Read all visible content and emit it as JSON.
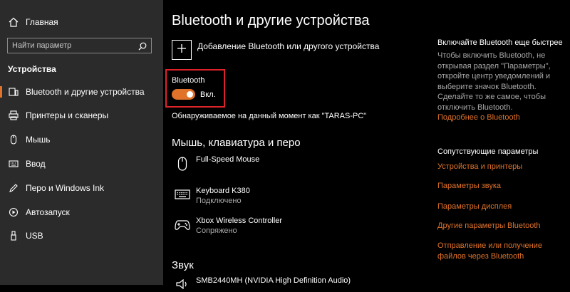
{
  "sidebar": {
    "home_label": "Главная",
    "search_placeholder": "Найти параметр",
    "section_label": "Устройства",
    "items": [
      {
        "label": "Bluetooth и другие устройства",
        "icon": "bluetooth-devices-icon"
      },
      {
        "label": "Принтеры и сканеры",
        "icon": "printer-icon"
      },
      {
        "label": "Мышь",
        "icon": "mouse-icon"
      },
      {
        "label": "Ввод",
        "icon": "keyboard-icon"
      },
      {
        "label": "Перо и Windows Ink",
        "icon": "pen-icon"
      },
      {
        "label": "Автозапуск",
        "icon": "autoplay-icon"
      },
      {
        "label": "USB",
        "icon": "usb-icon"
      }
    ]
  },
  "main": {
    "title": "Bluetooth и другие устройства",
    "add_label": "Добавление Bluetooth или другого устройства",
    "bluetooth_label": "Bluetooth",
    "toggle_state": "Вкл.",
    "toggle_on": true,
    "discoverable_text": "Обнаруживаемое на данный момент как \"TARAS-PC\"",
    "section_mouse": "Мышь, клавиатура и перо",
    "devices": [
      {
        "name": "Full-Speed Mouse",
        "status": "",
        "icon": "mouse-icon"
      },
      {
        "name": "Keyboard K380",
        "status": "Подключено",
        "icon": "keyboard-icon"
      },
      {
        "name": "Xbox Wireless Controller",
        "status": "Сопряжено",
        "icon": "gamepad-icon"
      }
    ],
    "section_sound": "Звук",
    "sound_devices": [
      {
        "name": "SMB2440MH (NVIDIA High Definition Audio)",
        "icon": "speaker-icon"
      }
    ]
  },
  "right_panel": {
    "tip_heading": "Включайте Bluetooth еще быстрее",
    "tip_text": "Чтобы включить Bluetooth, не открывая раздел \"Параметры\", откройте центр уведомлений и выберите значок Bluetooth. Сделайте то же самое, чтобы отключить Bluetooth.",
    "more_link": "Подробнее о Bluetooth",
    "related_heading": "Сопутствующие параметры",
    "links": [
      "Устройства и принтеры",
      "Параметры звука",
      "Параметры дисплея",
      "Другие параметры Bluetooth",
      "Отправление или получение файлов через Bluetooth"
    ]
  },
  "colors": {
    "accent": "#e0722a",
    "highlight": "#e0232a",
    "sidebar_bg": "#2b2b2b"
  }
}
